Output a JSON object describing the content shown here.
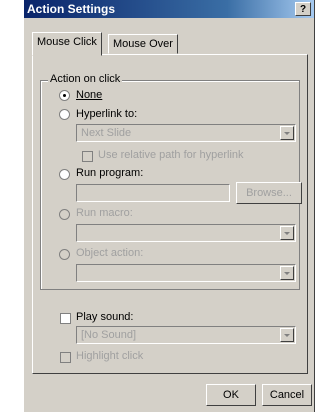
{
  "dialog": {
    "title": "Action Settings",
    "help": "?"
  },
  "tabs": [
    {
      "label": "Mouse Click"
    },
    {
      "label": "Mouse Over"
    }
  ],
  "group": {
    "title": "Action on click"
  },
  "options": {
    "none": "None",
    "hyperlink": "Hyperlink to:",
    "hyperlink_value": "Next Slide",
    "relative_path": "Use relative path for hyperlink",
    "run_program": "Run program:",
    "browse": "Browse...",
    "run_macro": "Run macro:",
    "object_action": "Object action:"
  },
  "sound": {
    "label": "Play sound:",
    "value": "[No Sound]"
  },
  "highlight": {
    "label": "Highlight click"
  },
  "buttons": {
    "ok": "OK",
    "cancel": "Cancel"
  }
}
